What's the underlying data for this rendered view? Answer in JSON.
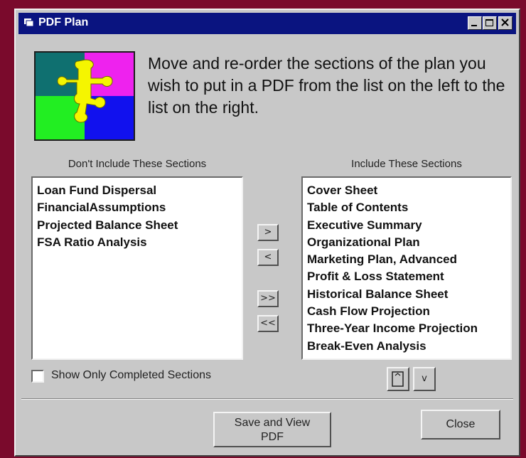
{
  "window": {
    "title": "PDF Plan"
  },
  "instructions": "Move and re-order the sections of the plan you wish to put in a PDF from the list on the left to the list on the right.",
  "left_list": {
    "label": "Don't Include These Sections",
    "items": [
      "Loan Fund Dispersal",
      "FinancialAssumptions",
      "Projected Balance Sheet",
      "FSA Ratio Analysis"
    ]
  },
  "right_list": {
    "label": "Include These Sections",
    "items": [
      "Cover Sheet",
      "Table of Contents",
      "Executive Summary",
      "Organizational Plan",
      "Marketing Plan, Advanced",
      "Profit & Loss Statement",
      "Historical Balance Sheet",
      "Cash Flow Projection",
      "Three-Year Income Projection",
      "Break-Even Analysis"
    ]
  },
  "move_buttons": {
    "add": ">",
    "remove": "<",
    "add_all": ">>",
    "remove_all": "<<"
  },
  "order_buttons": {
    "up": "^",
    "down": "v"
  },
  "show_completed": {
    "label": "Show Only Completed Sections",
    "checked": false
  },
  "buttons": {
    "save_line1": "Save and View",
    "save_line2": "PDF",
    "close": "Close"
  },
  "colors": {
    "title_bar": "#0a1480",
    "background": "#7a0a2c",
    "dialog": "#c8c8c8"
  }
}
